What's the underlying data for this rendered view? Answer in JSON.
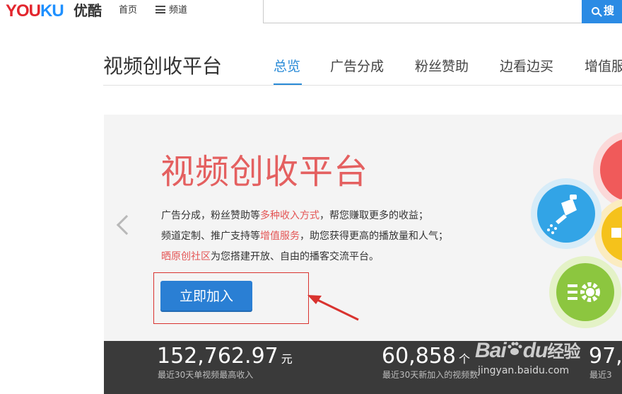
{
  "header": {
    "logo_text": "YOUKU",
    "logo_cn": "优酷",
    "nav": {
      "home": "首页",
      "channel": "频道"
    },
    "search": {
      "placeholder": "",
      "button_label": "搜"
    }
  },
  "section": {
    "title": "视频创收平台",
    "tabs": [
      "总览",
      "广告分成",
      "粉丝赞助",
      "边看边买",
      "增值服"
    ],
    "active_tab": "总览"
  },
  "banner": {
    "title": "视频创收平台",
    "line1": {
      "a": "广告分成，粉丝赞助等",
      "b": "多种收入方式",
      "c": "，帮您赚取更多的收益；"
    },
    "line2": {
      "a": "频道定制、推广支持等",
      "b": "增值服务",
      "c": "，助您获得更高的播放量和人气；"
    },
    "line3": {
      "a": "晒原创社区",
      "b": "为您搭建开放、自由的播客交流平台。"
    },
    "join_button": "立即加入",
    "icons": [
      "watering-can-icon",
      "coin-icon",
      "gear-list-icon",
      "red-circle-icon"
    ]
  },
  "stats": [
    {
      "value": "152,762.97",
      "unit": "元",
      "label": "最近30天单视频最高收入"
    },
    {
      "value": "60,858",
      "unit": "个",
      "label": "最近30天新加入的视频数"
    },
    {
      "value": "97,",
      "unit": "",
      "label": "最近3"
    }
  ],
  "watermark": {
    "brand": "Bai",
    "brand2": "du",
    "cn": "经验",
    "url": "jingyan.baidu.com"
  },
  "colors": {
    "accent": "#2a8bd7",
    "highlight": "#e45555",
    "stats_bg": "#3a3a3a"
  }
}
